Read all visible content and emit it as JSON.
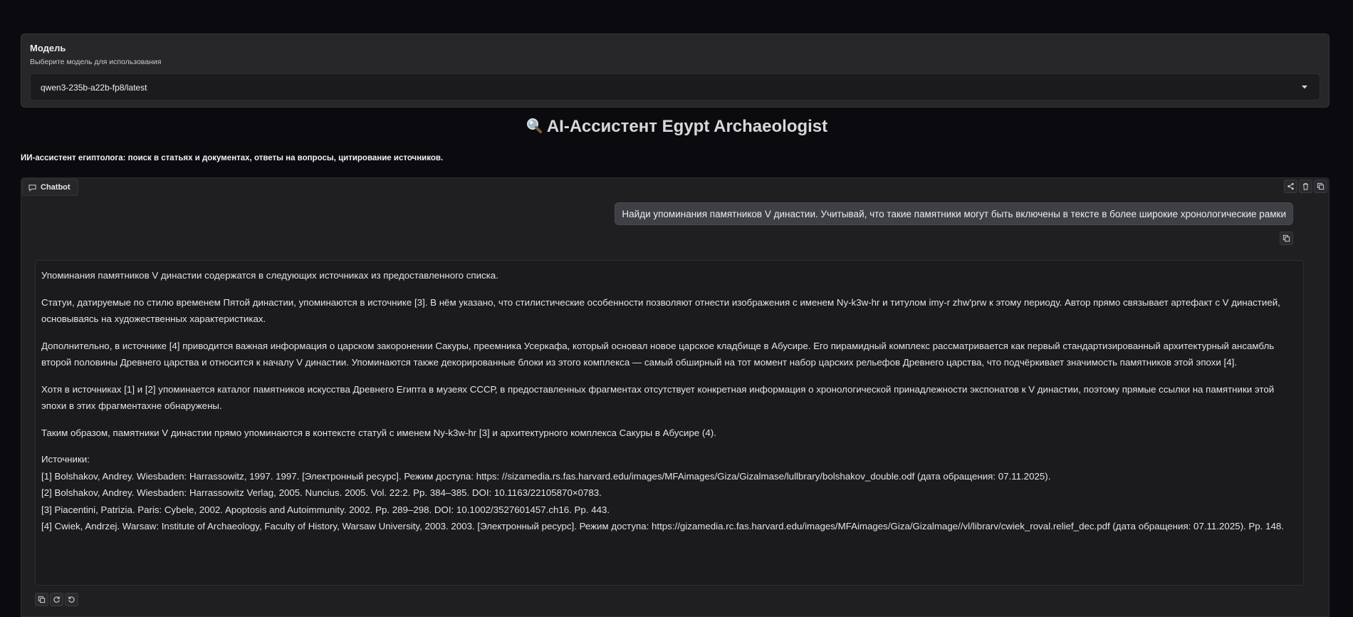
{
  "model": {
    "label": "Модель",
    "info": "Выберите модель для использования",
    "selected": "qwen3-235b-a22b-fp8/latest"
  },
  "app": {
    "title": "AI-Ассистент Egypt Archaeologist",
    "description": "ИИ-ассистент египтолога: поиск в статьях и документах, ответы на вопросы, цитирование источников."
  },
  "chatbot": {
    "label": "Chatbot",
    "icons": [
      "share-icon",
      "trash-icon",
      "copy-icon"
    ]
  },
  "messages": {
    "user": "Найди упоминания памятников V династии. Учитывай, что такие памятники могут быть включены в тексте в более широкие хронологические рамки",
    "bot": {
      "p1": "Упоминания памятников V династии содержатся в следующих источниках из предоставленного списка.",
      "p2": "Статуи, датируемые по стилю временем Пятой династии, упоминаются в источнике [3]. В нём указано, что стилистические особенности позволяют отнести изображения с именем Ny-k3w-hr и титулом imy-r zhw'prw к этому периоду. Автор прямо связывает артефакт с V династией, основываясь на художественных характеристиках.",
      "p3": "Дополнительно, в источнике [4] приводится важная информация о царском закоронении Сакуры, преемника Усеркафа, который основал новое царское кладбище в Абусире. Его пирамидный комплекс рассматривается как первый стандартизированный архитектурный ансамбль второй половины Древнего царства и относится к началу V династии. Упоминаются также декорированные блоки из этого комплекса — самый обширный на тот момент набор царских рельефов Древнего царства, что подчёркивает значимость памятников этой эпохи [4].",
      "p4": "Хотя в источниках [1] и [2] упоминается каталог памятников искусства Древнего Египта в музеях СССР, в предоставленных фрагментах отсутствует конкретная информация о хронологической принадлежности экспонатов к V династии, поэтому прямые ссылки на памятники этой эпохи в этих фрагментахне обнаружены.",
      "p5": "Таким образом, памятники V династии прямо упоминаются в контексте статуй с именем Ny-k3w-hr [3] и архитектурного комплекса Сакуры в Абусире (4).",
      "sources_title": "Источники:",
      "sources": [
        "[1] Bolshakov, Andrey. Wiesbaden: Harrassowitz, 1997. 1997. [Электронный ресурс]. Режим доступа: https: //sizamedia.rs.fas.harvard.edu/images/MFAimages/Giza/Gizalmase/lullbrary/bolshakov_double.odf (дата обращения: 07.11.2025).",
        "[2] Bolshakov, Andrey. Wiesbaden: Harrassowitz Verlag, 2005. Nuncius. 2005. Vol. 22:2. Pp. 384–385. DOI: 10.1163/22105870×0783.",
        "[3] Piacentini, Patrizia. Paris: Cybele, 2002. Apoptosis and Autoimmunity. 2002. Pp. 289–298. DOI: 10.1002/3527601457.ch16. Pp. 443.",
        "[4] Cwiek, Andrzej. Warsaw: Institute of Archaeology, Faculty of History, Warsaw University, 2003. 2003. [Электронный ресурс]. Режим доступа: https://gizamedia.rc.fas.harvard.edu/images/MFAimages/Giza/Gizalmage//vl/librarv/cwiek_roval.relief_dec.pdf (дата обращения: 07.11.2025). Pp. 148."
      ]
    }
  },
  "bot_actions": [
    "copy-icon",
    "retry-icon",
    "undo-icon"
  ]
}
